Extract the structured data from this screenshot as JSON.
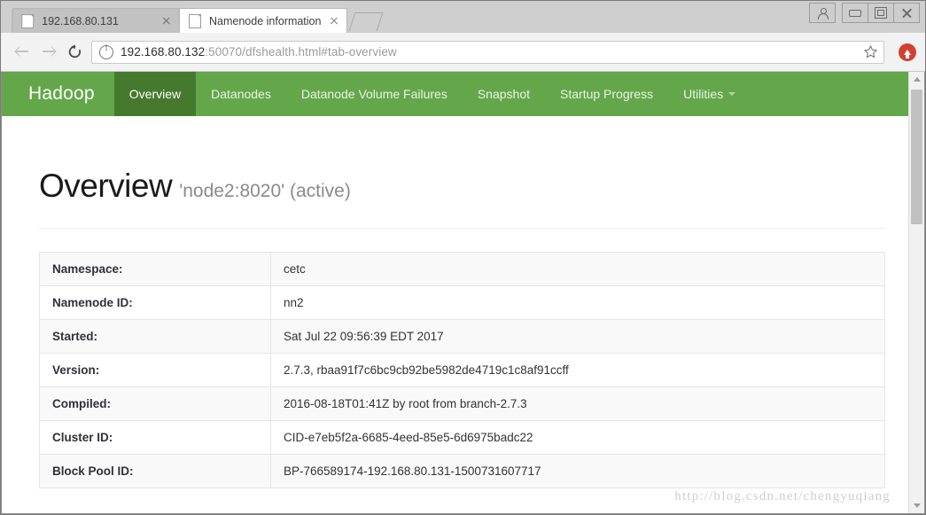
{
  "browser": {
    "tabs": [
      {
        "title": "192.168.80.131",
        "active": false
      },
      {
        "title": "Namenode information",
        "active": true
      }
    ],
    "address": {
      "host": "192.168.80.132",
      "path": ":50070/dfshealth.html#tab-overview",
      "full": "192.168.80.132:50070/dfshealth.html#tab-overview"
    },
    "icons": {
      "back": "back-arrow-icon",
      "forward": "forward-arrow-icon",
      "reload": "reload-icon",
      "site_info": "info-circle-icon",
      "bookmark": "star-icon",
      "update": "update-arrow-icon",
      "profile": "profile-icon",
      "minimize": "minimize-icon",
      "maximize": "maximize-icon",
      "close": "close-icon",
      "new_tab": "new-tab-icon"
    }
  },
  "hadoop": {
    "brand": "Hadoop",
    "nav": [
      {
        "label": "Overview",
        "active": true
      },
      {
        "label": "Datanodes",
        "active": false
      },
      {
        "label": "Datanode Volume Failures",
        "active": false
      },
      {
        "label": "Snapshot",
        "active": false
      },
      {
        "label": "Startup Progress",
        "active": false
      },
      {
        "label": "Utilities",
        "active": false,
        "dropdown": true
      }
    ],
    "page_title": "Overview",
    "page_subtitle": "'node2:8020' (active)",
    "table": {
      "rows": [
        {
          "label": "Namespace:",
          "value": "cetc"
        },
        {
          "label": "Namenode ID:",
          "value": "nn2"
        },
        {
          "label": "Started:",
          "value": "Sat Jul 22 09:56:39 EDT 2017"
        },
        {
          "label": "Version:",
          "value": "2.7.3, rbaa91f7c6bc9cb92be5982de4719c1c8af91ccff"
        },
        {
          "label": "Compiled:",
          "value": "2016-08-18T01:41Z by root from branch-2.7.3"
        },
        {
          "label": "Cluster ID:",
          "value": "CID-e7eb5f2a-6685-4eed-85e5-6d6975badc22"
        },
        {
          "label": "Block Pool ID:",
          "value": "BP-766589174-192.168.80.131-1500731607717"
        }
      ]
    },
    "colors": {
      "navbar_green": "#63a74a",
      "navbar_active_green": "#457a2e",
      "update_red": "#d34033"
    }
  },
  "watermark": "http://blog.csdn.net/chengyuqiang"
}
